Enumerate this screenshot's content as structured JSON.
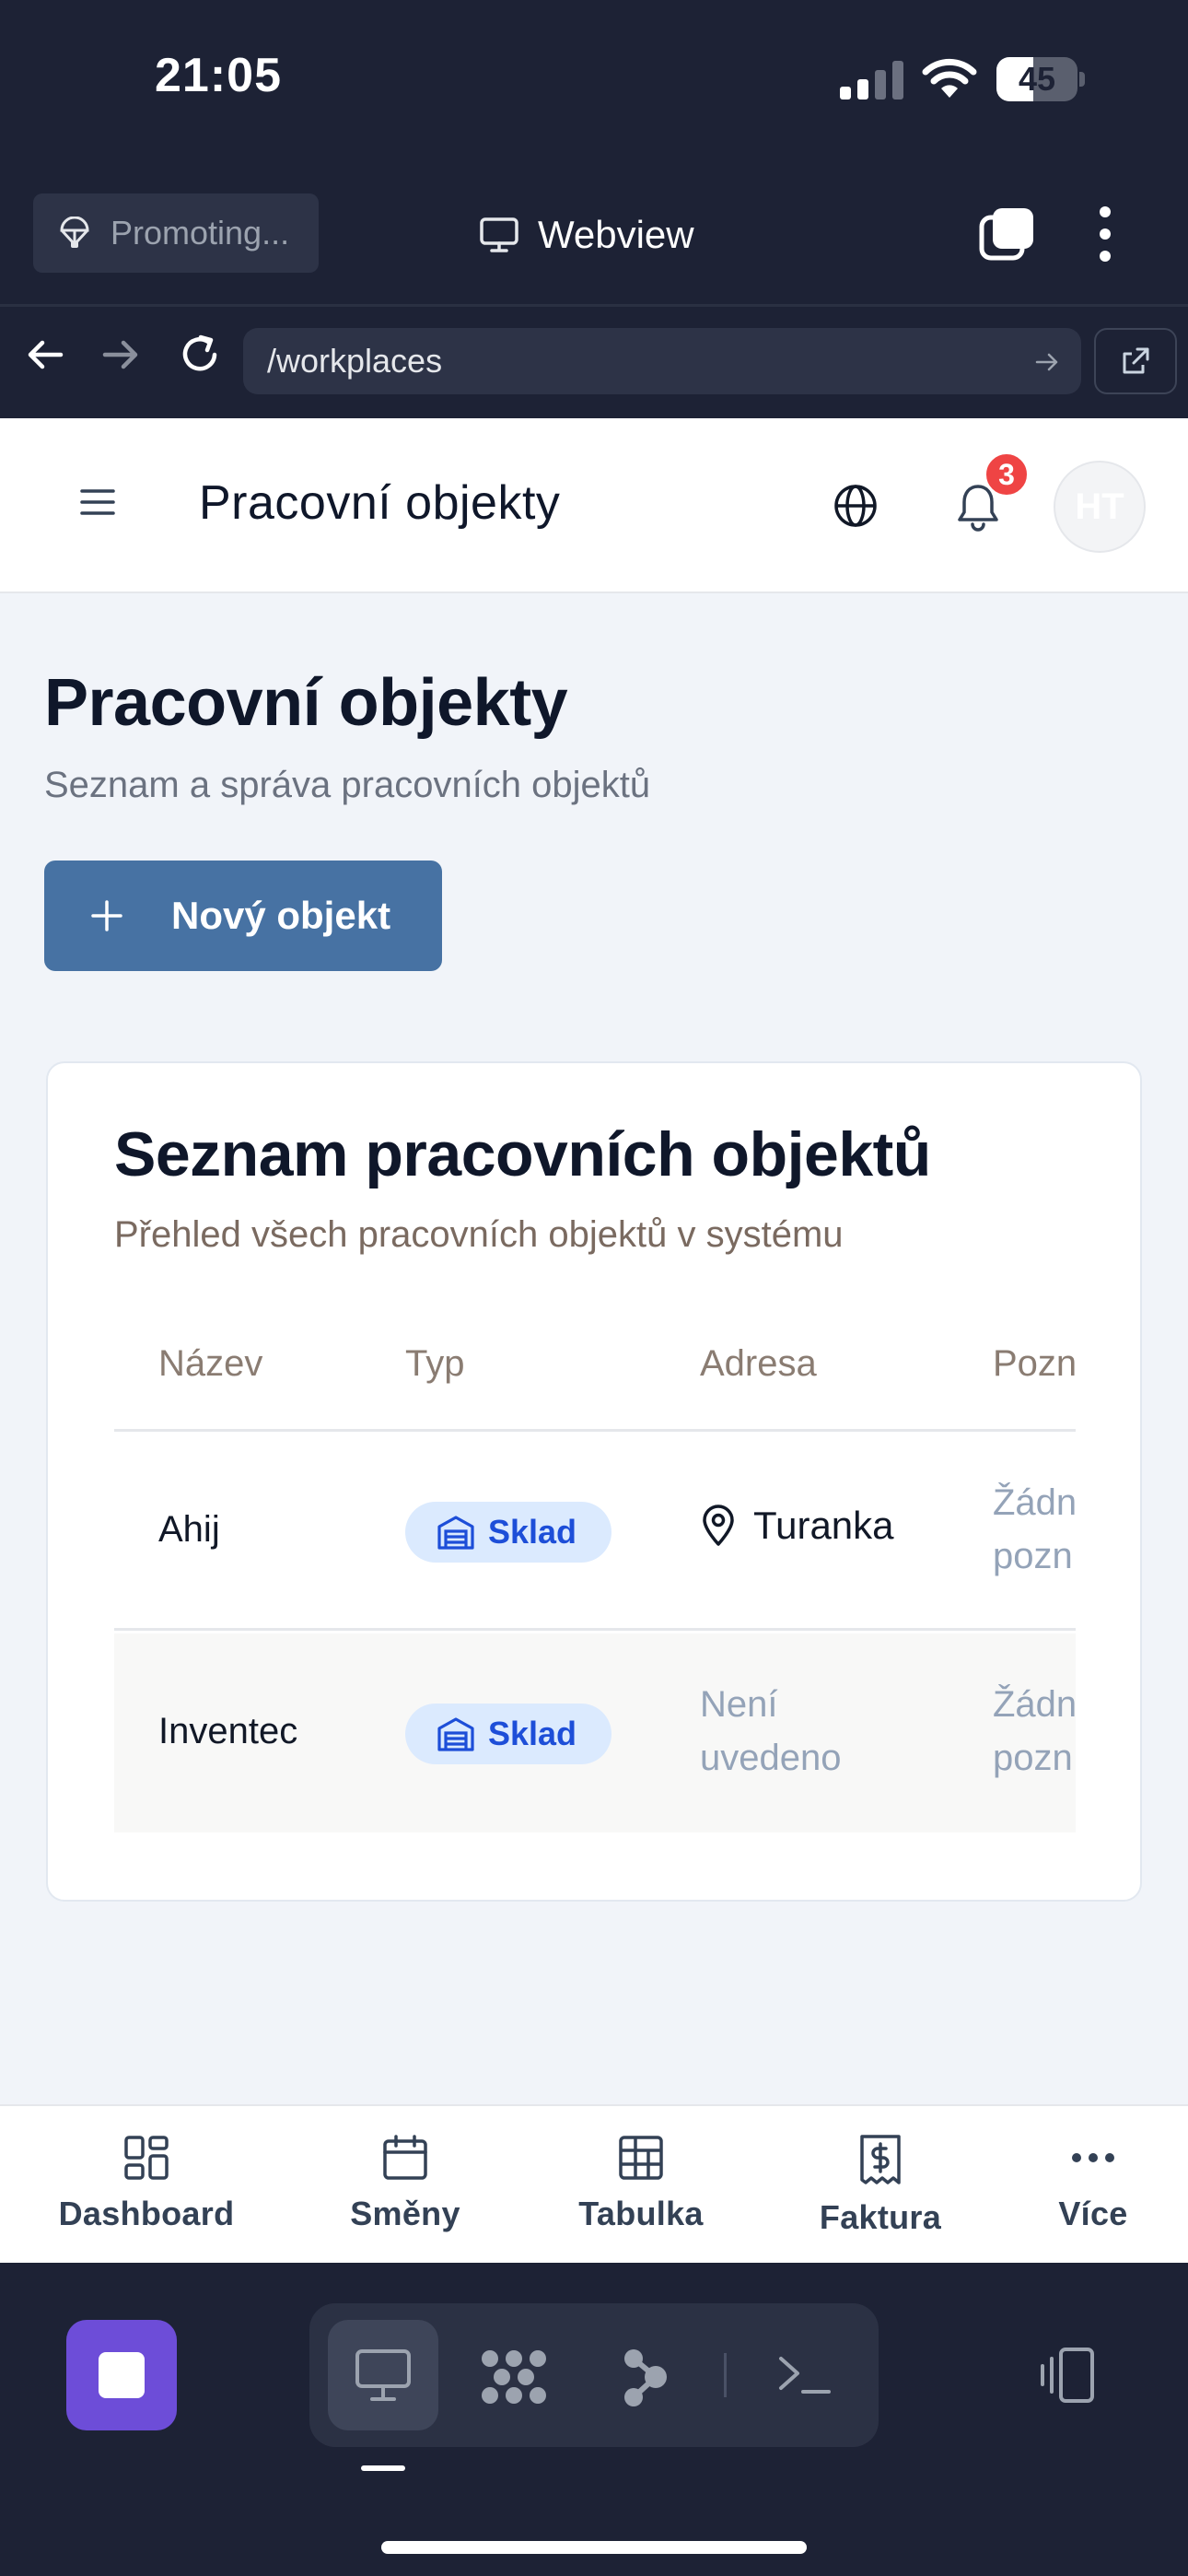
{
  "status_bar": {
    "time": "21:05",
    "battery": "45",
    "battery_level": 0.45
  },
  "webview_bar": {
    "promo_label": "Promoting...",
    "title": "Webview"
  },
  "url_bar": {
    "url": "/workplaces"
  },
  "app_header": {
    "title": "Pracovní objekty",
    "notification_count": "3",
    "avatar_initials": "HT"
  },
  "page": {
    "heading": "Pracovní objekty",
    "subheading": "Seznam a správa pracovních objektů",
    "new_button_label": "Nový objekt"
  },
  "card": {
    "title": "Seznam pracovních objektů",
    "subtitle": "Přehled všech pracovních objektů v systému",
    "columns": [
      "Název",
      "Typ",
      "Adresa",
      "Pozn"
    ],
    "rows": [
      {
        "name": "Ahij",
        "type": "Sklad",
        "address": "Turanka",
        "note_line1": "Žádn",
        "note_line2": "pozn"
      },
      {
        "name": "Inventec",
        "type": "Sklad",
        "address_line1": "Není",
        "address_line2": "uvedeno",
        "note_line1": "Žádn",
        "note_line2": "pozn"
      }
    ]
  },
  "bottom_nav": {
    "items": [
      {
        "label": "Dashboard",
        "icon": "dashboard-icon"
      },
      {
        "label": "Směny",
        "icon": "calendar-icon"
      },
      {
        "label": "Tabulka",
        "icon": "table-icon"
      },
      {
        "label": "Faktura",
        "icon": "invoice-icon"
      },
      {
        "label": "Více",
        "icon": "more-icon"
      }
    ]
  },
  "colors": {
    "accent": "#4772a3",
    "badge": "#ef4444",
    "pill_bg": "#dbeafe",
    "pill_text": "#1d4ed8",
    "dock_bg": "#1d2235",
    "stop_button": "#6d4dd8"
  }
}
